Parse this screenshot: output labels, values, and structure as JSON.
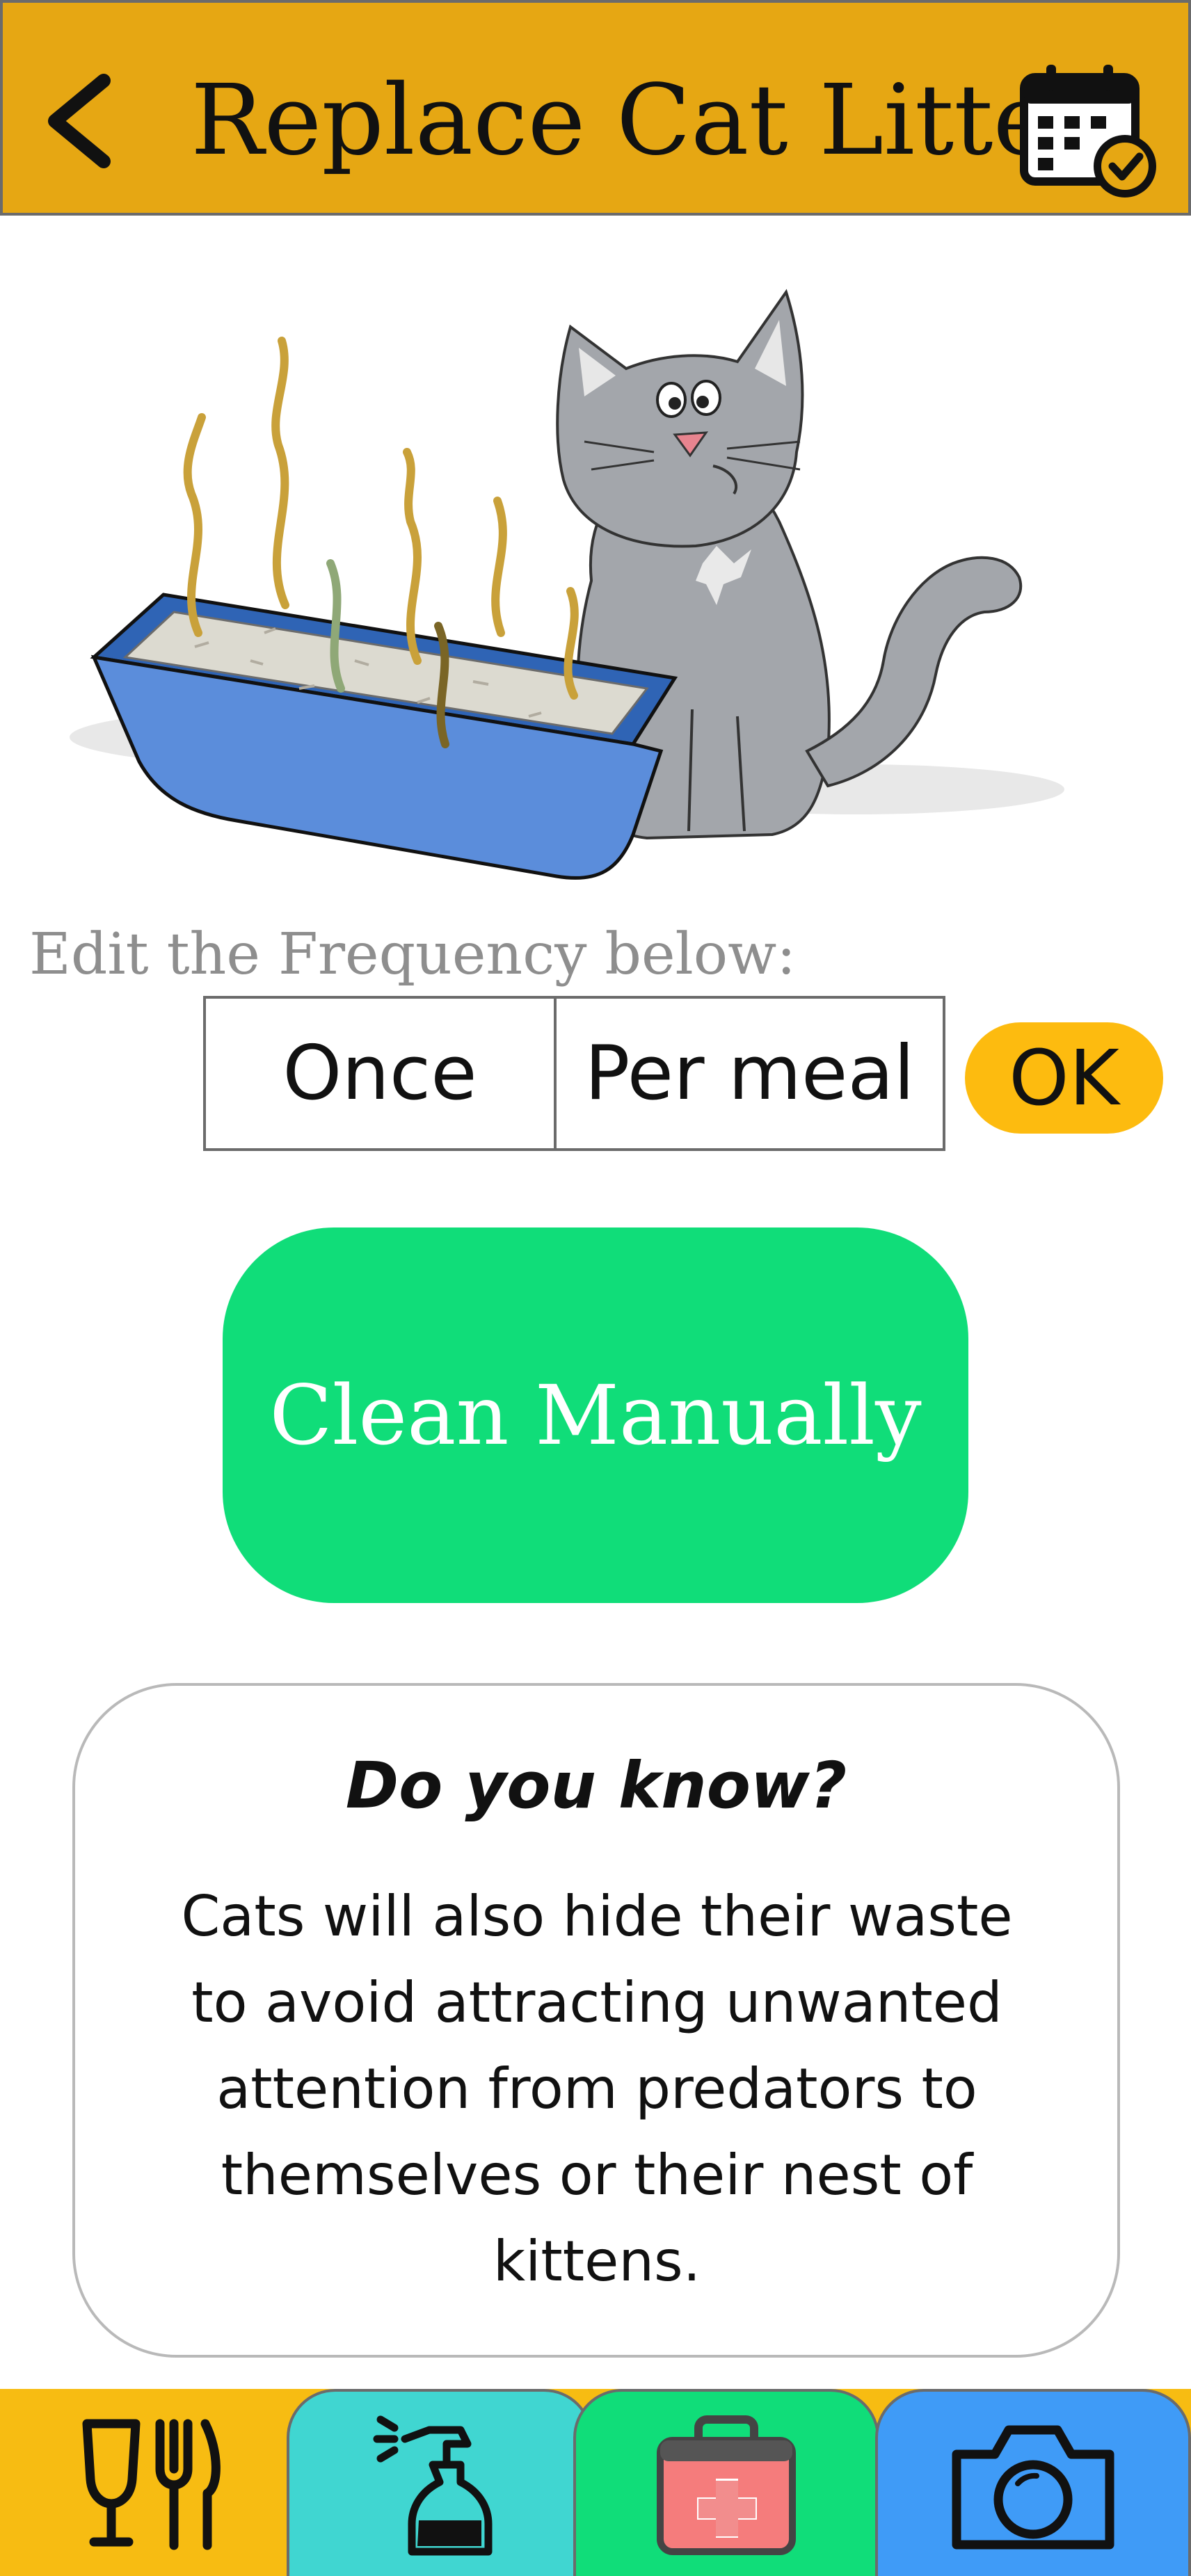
{
  "header": {
    "title": "Replace Cat Litter",
    "back_icon": "chevron-left-icon",
    "calendar_icon": "calendar-check-icon",
    "background_color": "#e6a713"
  },
  "frequency": {
    "label": "Edit the Frequency below:",
    "count_value": "Once",
    "period_value": "Per meal",
    "ok_label": "OK",
    "ok_color": "#fdbb0f"
  },
  "action": {
    "clean_label": "Clean Manually",
    "clean_color": "#10dd79"
  },
  "info_card": {
    "title": "Do you know?",
    "text": "Cats will also hide their waste to avoid attracting unwanted attention from predators to themselves or their nest of kittens."
  },
  "tabbar": {
    "tabs": [
      {
        "name": "food",
        "icon": "fork-knife-glass-icon",
        "color": "#f7bc12"
      },
      {
        "name": "clean",
        "icon": "spray-bottle-icon",
        "color": "#40d6d1"
      },
      {
        "name": "health",
        "icon": "first-aid-kit-icon",
        "color": "#10dd79"
      },
      {
        "name": "camera",
        "icon": "camera-icon",
        "color": "#3f9bf7"
      }
    ]
  }
}
